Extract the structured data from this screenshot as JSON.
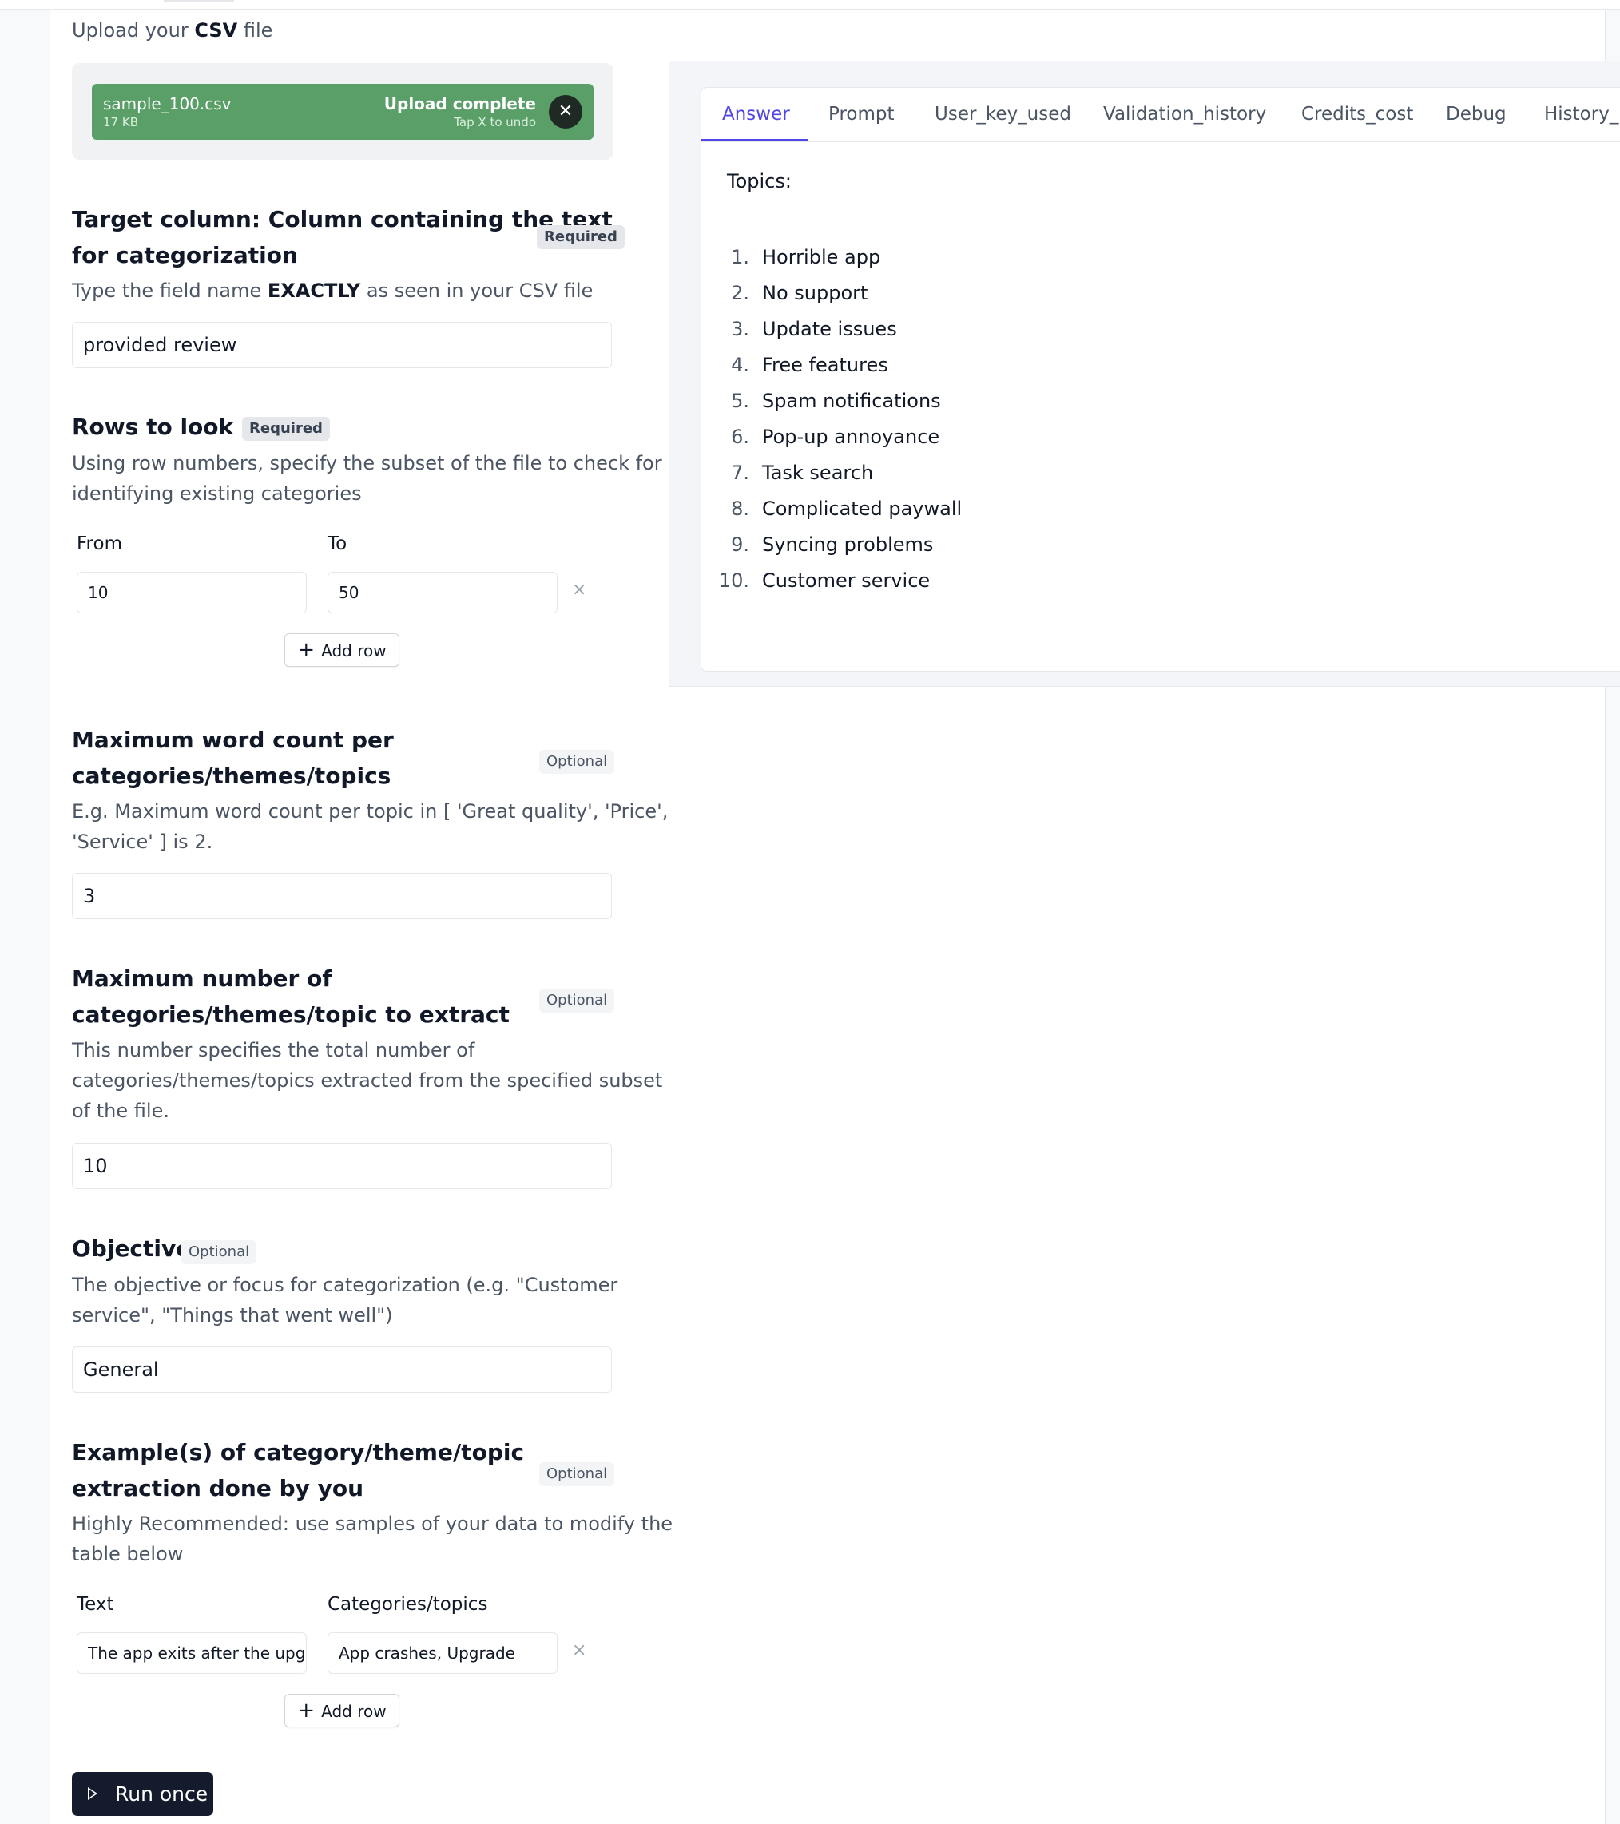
{
  "upload": {
    "title_prefix": "Upload your",
    "title_bold": "CSV",
    "title_suffix": "file",
    "file_name": "sample_100.csv",
    "file_size": "17 KB",
    "status": "Upload complete",
    "undo_hint": "Tap X to undo",
    "close_glyph": "✕"
  },
  "target_column": {
    "label_line1": "Target column: Column containing the text",
    "label_line2": "for categorization",
    "badge": "Required",
    "hint_prefix": "Type the field name",
    "hint_bold": "EXACTLY",
    "hint_suffix": "as seen in your CSV file",
    "value": "provided review"
  },
  "rows": {
    "label": "Rows to look at",
    "badge": "Required",
    "hint_line1": "Using row numbers, specify the subset of the file to check for",
    "hint_line2": "identifying existing categories",
    "col_from": "From",
    "col_to": "To",
    "from_value": "10",
    "to_value": "50",
    "remove_glyph": "×",
    "add_row": "Add row"
  },
  "max_words": {
    "label_line1": "Maximum word count per",
    "label_line2": "categories/themes/topics",
    "badge": "Optional",
    "hint_line1": "E.g. Maximum word count per topic in [ 'Great quality', 'Price',",
    "hint_line2": "'Service' ] is 2.",
    "value": "3"
  },
  "max_categories": {
    "label_line1": "Maximum number of",
    "label_line2": "categories/themes/topic to extract",
    "badge": "Optional",
    "hint_line1": "This number specifies the total number of",
    "hint_line2": "categories/themes/topics extracted from the specified subset",
    "hint_line3": "of the file.",
    "value": "10"
  },
  "objective": {
    "label": "Objective",
    "badge": "Optional",
    "hint_line1": "The objective or focus for categorization (e.g. \"Customer",
    "hint_line2": "service\", \"Things that went well\")",
    "value": "General"
  },
  "examples": {
    "label_line1": "Example(s) of category/theme/topic",
    "label_line2": "extraction done by you",
    "badge": "Optional",
    "hint_line1": "Highly Recommended: use samples of your data to modify the",
    "hint_line2": "table below",
    "col_text": "Text",
    "col_categories": "Categories/topics",
    "text_value": "The app exits after the upgrade",
    "categories_value": "App crashes, Upgrade",
    "remove_glyph": "×",
    "add_row": "Add row"
  },
  "run_button": "Run once",
  "output": {
    "tabs": [
      "Answer",
      "Prompt",
      "User_key_used",
      "Validation_history",
      "Credits_cost",
      "Debug",
      "History_i"
    ],
    "active_tab": "Answer",
    "topics_label": "Topics:",
    "topics": [
      "Horrible app",
      "No support",
      "Update issues",
      "Free features",
      "Spam notifications",
      "Pop-up annoyance",
      "Task search",
      "Complicated paywall",
      "Syncing problems",
      "Customer service"
    ],
    "topic_numbers": [
      "1.",
      "2.",
      "3.",
      "4.",
      "5.",
      "6.",
      "7.",
      "8.",
      "9.",
      "10."
    ]
  },
  "colors": {
    "accent": "#4f46e5",
    "upload_success": "#5a9e68",
    "run_button_bg": "#131b2d"
  }
}
